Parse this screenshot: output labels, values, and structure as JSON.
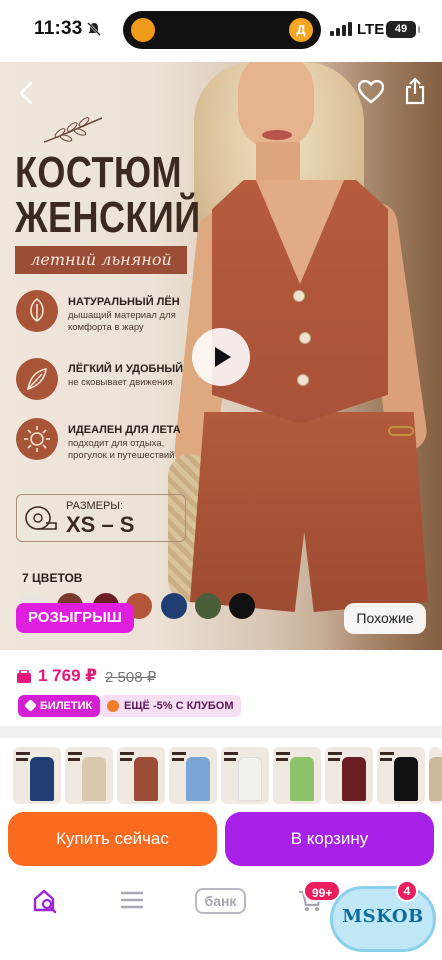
{
  "status_bar": {
    "time": "11:33",
    "network": "LTE",
    "battery": "49",
    "island_right_icon": "Д"
  },
  "hero": {
    "title_line1": "КОСТЮМ",
    "title_line2": "ЖЕНСКИЙ",
    "subtitle": "летний льняной",
    "features": [
      {
        "icon": "leaf-icon",
        "title": "НАТУРАЛЬНЫЙ ЛЁН",
        "desc": "дышащий материал для комфорта в жару"
      },
      {
        "icon": "feather-icon",
        "title": "ЛЁГКИЙ И УДОБНЫЙ",
        "desc": "не сковывает движения"
      },
      {
        "icon": "sun-icon",
        "title": "ИДЕАЛЕН ДЛЯ ЛЕТА",
        "desc": "подходит для отдыха, прогулок и путешествий"
      }
    ],
    "sizes_label": "РАЗМЕРЫ:",
    "sizes_value": "XS – S",
    "colors_label": "7 ЦВЕТОВ",
    "swatches": [
      "#e9e4df",
      "#7a3a2f",
      "#6b1f24",
      "#b4543a",
      "#1f3f74",
      "#4a5e3a",
      "#111111"
    ],
    "raffle_label": "РОЗЫГРЫШ",
    "similar_label": "Похожие"
  },
  "pricing": {
    "price": "1 769 ₽",
    "old_price": "2 508 ₽",
    "ticket_badge": "БИЛЕТИК",
    "club_badge": "ЕЩЁ -5% С КЛУБОМ"
  },
  "thumbnails": [
    {
      "color": "#1f3f74"
    },
    {
      "color": "#d9c8ad"
    },
    {
      "color": "#9b4d36"
    },
    {
      "color": "#7aa6d6"
    },
    {
      "color": "#f4f1ec"
    },
    {
      "color": "#8dc36b"
    },
    {
      "color": "#6b1f24"
    },
    {
      "color": "#111111"
    },
    {
      "color": "#cdb89a"
    }
  ],
  "actions": {
    "buy_now": "Купить сейчас",
    "add_to_cart": "В корзину"
  },
  "bottom_nav": {
    "bank_label": "банк",
    "cart_badge": "99+",
    "profile_badge": "4",
    "watermark": "MSKOB"
  },
  "colors": {
    "accent_pink": "#e3187a",
    "buy_orange": "#fb6b1f",
    "cart_purple": "#a721e8",
    "raffle_magenta": "#e01ee0"
  }
}
